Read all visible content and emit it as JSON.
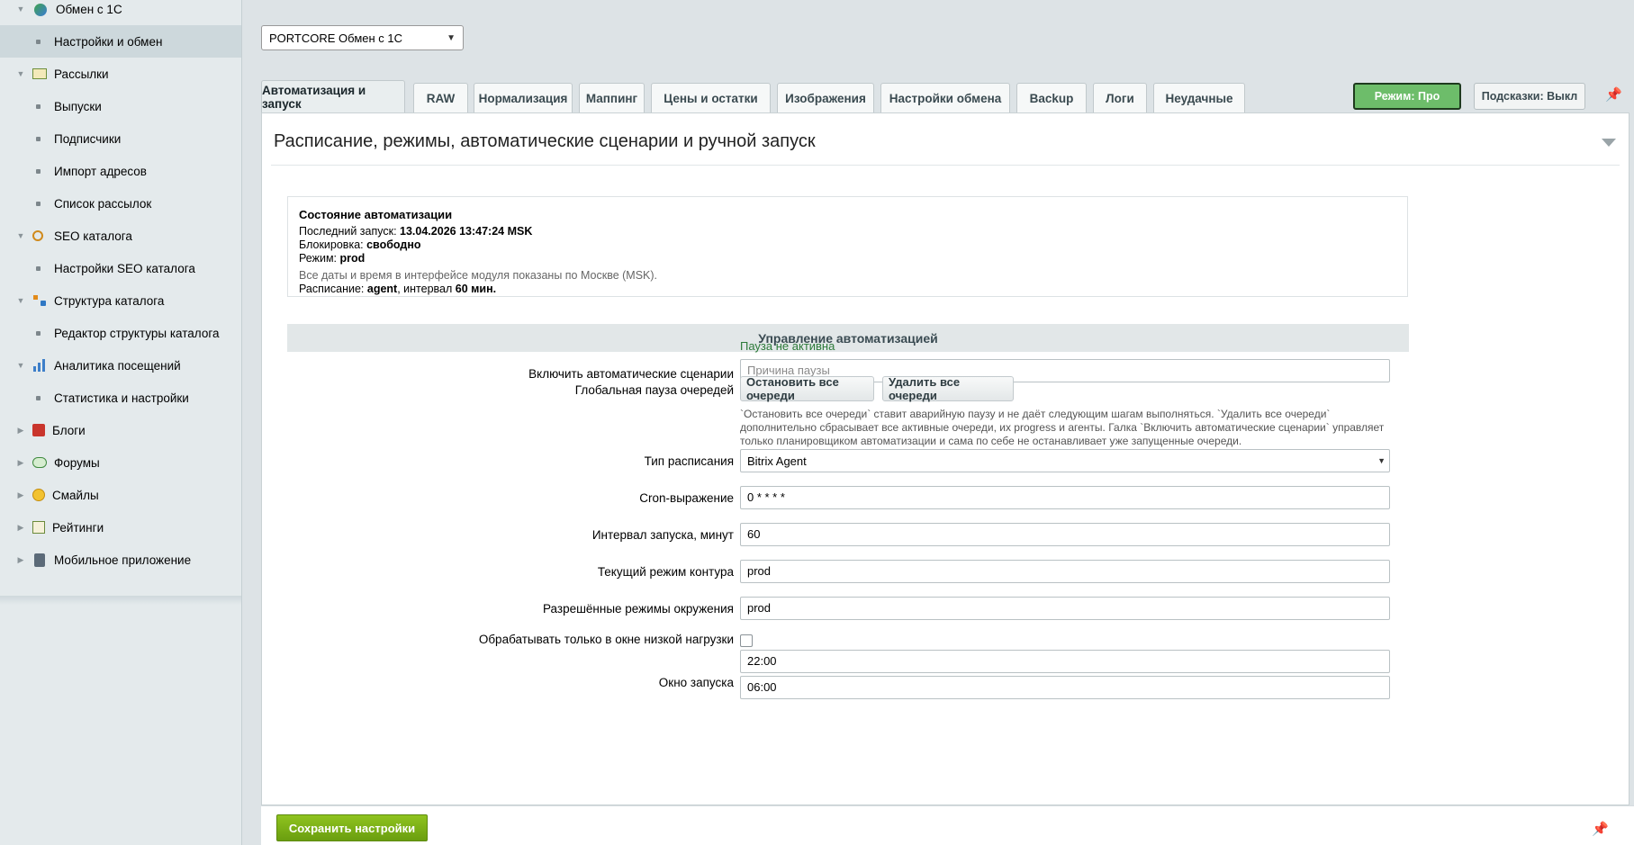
{
  "sidebar": {
    "items": [
      {
        "label": "Обмен с 1С",
        "level": "top",
        "expand": "open",
        "icon": "exchange-1c-icon"
      },
      {
        "label": "Настройки и обмен",
        "level": "sub",
        "active": true
      },
      {
        "label": "Рассылки",
        "level": "top",
        "expand": "open",
        "icon": "mail-icon"
      },
      {
        "label": "Выпуски",
        "level": "sub"
      },
      {
        "label": "Подписчики",
        "level": "sub"
      },
      {
        "label": "Импорт адресов",
        "level": "sub"
      },
      {
        "label": "Список рассылок",
        "level": "sub"
      },
      {
        "label": "SEO каталога",
        "level": "top",
        "expand": "open",
        "icon": "seo-icon"
      },
      {
        "label": "Настройки SEO каталога",
        "level": "sub"
      },
      {
        "label": "Структура каталога",
        "level": "top",
        "expand": "open",
        "icon": "structure-icon"
      },
      {
        "label": "Редактор структуры каталога",
        "level": "sub"
      },
      {
        "label": "Аналитика посещений",
        "level": "top",
        "expand": "open",
        "icon": "analytics-icon"
      },
      {
        "label": "Статистика и настройки",
        "level": "sub"
      },
      {
        "label": "Блоги",
        "level": "top",
        "expand": "closed",
        "icon": "blog-icon"
      },
      {
        "label": "Форумы",
        "level": "top",
        "expand": "closed",
        "icon": "forum-icon"
      },
      {
        "label": "Смайлы",
        "level": "top",
        "expand": "closed",
        "icon": "smile-icon"
      },
      {
        "label": "Рейтинги",
        "level": "top",
        "expand": "closed",
        "icon": "rating-icon"
      },
      {
        "label": "Мобильное приложение",
        "level": "top",
        "expand": "closed",
        "icon": "mobile-icon"
      }
    ]
  },
  "site_select": {
    "value": "PORTCORE Обмен с 1С"
  },
  "tabs": [
    {
      "label": "Автоматизация и запуск",
      "active": true
    },
    {
      "label": "RAW"
    },
    {
      "label": "Нормализация"
    },
    {
      "label": "Маппинг"
    },
    {
      "label": "Цены и остатки"
    },
    {
      "label": "Изображения"
    },
    {
      "label": "Настройки обмена"
    },
    {
      "label": "Backup"
    },
    {
      "label": "Логи"
    },
    {
      "label": "Неудачные"
    }
  ],
  "toolbar": {
    "mode_label": "Режим: Про",
    "hints_label": "Подсказки: Выкл",
    "mode_color": "#6dbd6a"
  },
  "panel": {
    "title": "Расписание, режимы, автоматические сценарии и ручной запуск"
  },
  "status": {
    "title": "Состояние автоматизации",
    "last_run_label": "Последний запуск: ",
    "last_run_value": "13.04.2026 13:47:24 MSK",
    "lock_label": "Блокировка: ",
    "lock_value": "свободно",
    "mode_label": "Режим: ",
    "mode_value": "prod",
    "tz_note": "Все даты и время в интерфейсе модуля показаны по Москве (MSK).",
    "schedule_label": "Расписание: ",
    "schedule_type": "agent",
    "schedule_mid": ", интервал ",
    "schedule_interval": "60 мин."
  },
  "section": {
    "title": "Управление автоматизацией"
  },
  "form": {
    "auto_enable_label": "Включить автоматические сценарии",
    "auto_enable_checked": true,
    "pause_status": "Пауза не активна",
    "pause_reason_placeholder": "Причина паузы",
    "global_pause_label": "Глобальная пауза очередей",
    "stop_all_label": "Остановить все очереди",
    "delete_all_label": "Удалить все очереди",
    "pause_hint": "`Остановить все очереди` ставит аварийную паузу и не даёт следующим шагам выполняться. `Удалить все очереди` дополнительно сбрасывает все активные очереди, их progress и агенты. Галка `Включить автоматические сценарии` управляет только планировщиком автоматизации и сама по себе не останавливает уже запущенные очереди.",
    "schedule_type_label": "Тип расписания",
    "schedule_type_value": "Bitrix Agent",
    "cron_label": "Cron-выражение",
    "cron_value": "0 * * * *",
    "interval_label": "Интервал запуска, минут",
    "interval_value": "60",
    "contour_label": "Текущий режим контура",
    "contour_value": "prod",
    "allowed_label": "Разрешённые режимы окружения",
    "allowed_value": "prod",
    "lowload_label": "Обрабатывать только в окне низкой нагрузки",
    "lowload_checked": false,
    "window_label": "Окно запуска",
    "window_start": "22:00",
    "window_end": "06:00"
  },
  "footer": {
    "save_label": "Сохранить настройки",
    "save_color": "#7cb518"
  }
}
